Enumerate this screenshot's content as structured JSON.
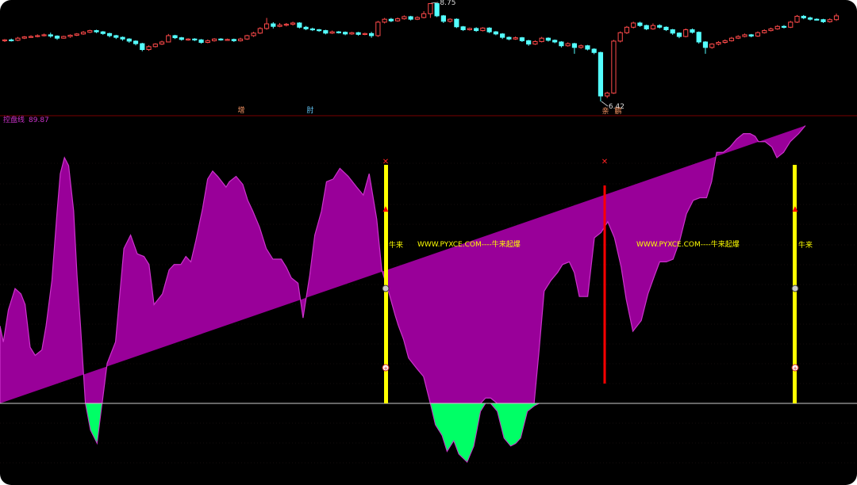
{
  "colors": {
    "background": "#000000",
    "candle_up": "#ff4a4a",
    "candle_down": "#54ffff",
    "divider": "#7a0000",
    "area_positive": "#990099",
    "area_positive_edge": "#cc33cc",
    "area_negative": "#00ff66",
    "signal_bar": "#ffff00",
    "signal_line": "#ff0000",
    "text_yellow": "#ffff00",
    "text_magenta": "#cc33cc"
  },
  "price_panel": {
    "max_label": "8.75",
    "min_label": "6.42",
    "markers": [
      "增",
      "肘",
      "亲",
      "鹏"
    ]
  },
  "indicator_panel": {
    "title": "控盘线",
    "value": "89.87",
    "signal_text": "牛来",
    "watermark": "WWW.PYXCE.COM----牛来起爆",
    "signal_icons": [
      "butterfly-icon",
      "arrow-up-icon",
      "money-bag-icon",
      "plus-circle-icon"
    ]
  },
  "chart_data": [
    {
      "type": "candlestick",
      "title": "",
      "y_marks": {
        "max": 8.75,
        "min": 6.42
      },
      "candles": [
        [
          7.86,
          7.88,
          7.9,
          7.83
        ],
        [
          7.88,
          7.87,
          7.91,
          7.84
        ],
        [
          7.87,
          7.92,
          7.95,
          7.85
        ],
        [
          7.92,
          7.95,
          7.97,
          7.9
        ],
        [
          7.95,
          7.96,
          7.99,
          7.93
        ],
        [
          7.96,
          7.98,
          8.01,
          7.94
        ],
        [
          7.98,
          8.0,
          8.03,
          7.96
        ],
        [
          8.0,
          7.97,
          8.05,
          7.93
        ],
        [
          7.97,
          7.92,
          7.99,
          7.88
        ],
        [
          7.92,
          7.96,
          7.98,
          7.91
        ],
        [
          7.96,
          7.99,
          8.01,
          7.93
        ],
        [
          7.99,
          8.02,
          8.04,
          7.97
        ],
        [
          8.02,
          8.06,
          8.09,
          8.0
        ],
        [
          8.06,
          8.1,
          8.12,
          8.04
        ],
        [
          8.1,
          8.07,
          8.12,
          8.04
        ],
        [
          8.07,
          8.03,
          8.09,
          8.0
        ],
        [
          8.03,
          7.98,
          8.05,
          7.94
        ],
        [
          7.98,
          7.94,
          8.0,
          7.9
        ],
        [
          7.94,
          7.9,
          7.96,
          7.86
        ],
        [
          7.9,
          7.85,
          7.92,
          7.81
        ],
        [
          7.85,
          7.79,
          7.87,
          7.75
        ],
        [
          7.79,
          7.65,
          7.81,
          7.61
        ],
        [
          7.65,
          7.72,
          7.75,
          7.62
        ],
        [
          7.72,
          7.78,
          7.8,
          7.7
        ],
        [
          7.78,
          7.83,
          7.86,
          7.76
        ],
        [
          7.83,
          7.98,
          8.02,
          7.82
        ],
        [
          7.98,
          7.93,
          8.0,
          7.9
        ],
        [
          7.93,
          7.89,
          7.95,
          7.86
        ],
        [
          7.89,
          7.9,
          7.92,
          7.86
        ],
        [
          7.9,
          7.88,
          7.92,
          7.85
        ],
        [
          7.88,
          7.82,
          7.9,
          7.79
        ],
        [
          7.82,
          7.86,
          7.89,
          7.8
        ],
        [
          7.86,
          7.9,
          7.92,
          7.84
        ],
        [
          7.9,
          7.88,
          7.92,
          7.86
        ],
        [
          7.88,
          7.89,
          7.91,
          7.86
        ],
        [
          7.89,
          7.86,
          7.91,
          7.83
        ],
        [
          7.86,
          7.9,
          7.93,
          7.84
        ],
        [
          7.9,
          7.98,
          8.0,
          7.88
        ],
        [
          7.98,
          8.04,
          8.07,
          7.95
        ],
        [
          8.04,
          8.15,
          8.18,
          8.02
        ],
        [
          8.15,
          8.26,
          8.4,
          8.12
        ],
        [
          8.26,
          8.2,
          8.3,
          8.15
        ],
        [
          8.2,
          8.23,
          8.28,
          8.18
        ],
        [
          8.23,
          8.25,
          8.28,
          8.2
        ],
        [
          8.25,
          8.28,
          8.31,
          8.22
        ],
        [
          8.28,
          8.18,
          8.3,
          8.15
        ],
        [
          8.18,
          8.14,
          8.21,
          8.11
        ],
        [
          8.14,
          8.12,
          8.17,
          8.09
        ],
        [
          8.12,
          8.1,
          8.14,
          8.07
        ],
        [
          8.1,
          8.04,
          8.12,
          8.01
        ],
        [
          8.04,
          8.07,
          8.1,
          8.02
        ],
        [
          8.07,
          8.06,
          8.09,
          8.03
        ],
        [
          8.06,
          8.02,
          8.08,
          7.99
        ],
        [
          8.02,
          8.05,
          8.07,
          8.0
        ],
        [
          8.05,
          8.01,
          8.07,
          7.98
        ],
        [
          8.01,
          8.03,
          8.05,
          7.99
        ],
        [
          8.03,
          7.98,
          8.07,
          7.93
        ],
        [
          7.98,
          8.3,
          8.33,
          7.95
        ],
        [
          8.3,
          8.37,
          8.4,
          8.27
        ],
        [
          8.37,
          8.33,
          8.4,
          8.3
        ],
        [
          8.33,
          8.38,
          8.41,
          8.31
        ],
        [
          8.38,
          8.43,
          8.46,
          8.36
        ],
        [
          8.43,
          8.37,
          8.45,
          8.34
        ],
        [
          8.37,
          8.41,
          8.44,
          8.35
        ],
        [
          8.41,
          8.5,
          8.56,
          8.39
        ],
        [
          8.5,
          8.74,
          8.75,
          8.4
        ],
        [
          8.74,
          8.45,
          8.75,
          8.42
        ],
        [
          8.45,
          8.32,
          8.47,
          8.28
        ],
        [
          8.32,
          8.37,
          8.39,
          8.29
        ],
        [
          8.37,
          8.19,
          8.39,
          8.16
        ],
        [
          8.19,
          8.12,
          8.21,
          8.09
        ],
        [
          8.12,
          8.15,
          8.17,
          8.1
        ],
        [
          8.15,
          8.1,
          8.18,
          8.07
        ],
        [
          8.1,
          8.16,
          8.18,
          8.08
        ],
        [
          8.16,
          8.07,
          8.18,
          8.04
        ],
        [
          8.07,
          8.02,
          8.09,
          7.99
        ],
        [
          8.02,
          7.94,
          8.04,
          7.9
        ],
        [
          7.94,
          7.9,
          7.96,
          7.87
        ],
        [
          7.9,
          7.93,
          7.96,
          7.88
        ],
        [
          7.93,
          7.86,
          7.95,
          7.83
        ],
        [
          7.86,
          7.78,
          7.88,
          7.74
        ],
        [
          7.78,
          7.84,
          7.87,
          7.76
        ],
        [
          7.84,
          7.92,
          7.95,
          7.82
        ],
        [
          7.92,
          7.87,
          7.94,
          7.84
        ],
        [
          7.87,
          7.83,
          7.89,
          7.8
        ],
        [
          7.83,
          7.74,
          7.85,
          7.7
        ],
        [
          7.74,
          7.79,
          7.82,
          7.72
        ],
        [
          7.79,
          7.7,
          7.81,
          7.55
        ],
        [
          7.7,
          7.74,
          7.77,
          7.67
        ],
        [
          7.74,
          7.66,
          7.76,
          7.63
        ],
        [
          7.66,
          7.58,
          7.68,
          7.54
        ],
        [
          7.58,
          6.55,
          7.6,
          6.42
        ],
        [
          6.55,
          6.62,
          6.65,
          6.5
        ],
        [
          6.62,
          7.85,
          7.88,
          6.6
        ],
        [
          7.85,
          8.05,
          8.08,
          7.82
        ],
        [
          8.05,
          8.18,
          8.21,
          8.02
        ],
        [
          8.18,
          8.28,
          8.31,
          8.15
        ],
        [
          8.28,
          8.22,
          8.31,
          8.19
        ],
        [
          8.22,
          8.14,
          8.24,
          8.11
        ],
        [
          8.14,
          8.22,
          8.27,
          8.12
        ],
        [
          8.22,
          8.18,
          8.25,
          8.15
        ],
        [
          8.18,
          8.12,
          8.2,
          8.09
        ],
        [
          8.12,
          8.04,
          8.14,
          8.0
        ],
        [
          8.04,
          7.96,
          8.06,
          7.92
        ],
        [
          7.96,
          8.12,
          8.15,
          7.94
        ],
        [
          8.12,
          8.06,
          8.15,
          8.03
        ],
        [
          8.06,
          7.83,
          8.08,
          7.79
        ],
        [
          7.83,
          7.7,
          7.85,
          7.55
        ],
        [
          7.7,
          7.78,
          7.8,
          7.67
        ],
        [
          7.78,
          7.82,
          7.85,
          7.75
        ],
        [
          7.82,
          7.86,
          7.89,
          7.79
        ],
        [
          7.86,
          7.92,
          7.95,
          7.84
        ],
        [
          7.92,
          7.96,
          7.99,
          7.9
        ],
        [
          7.96,
          8.0,
          8.03,
          7.94
        ],
        [
          8.0,
          7.97,
          8.02,
          7.94
        ],
        [
          7.97,
          8.05,
          8.08,
          7.95
        ],
        [
          8.05,
          8.1,
          8.13,
          8.03
        ],
        [
          8.1,
          8.14,
          8.17,
          8.08
        ],
        [
          8.14,
          8.2,
          8.23,
          8.12
        ],
        [
          8.2,
          8.18,
          8.23,
          8.15
        ],
        [
          8.18,
          8.3,
          8.33,
          8.16
        ],
        [
          8.3,
          8.44,
          8.47,
          8.28
        ],
        [
          8.44,
          8.4,
          8.47,
          8.37
        ],
        [
          8.4,
          8.37,
          8.43,
          8.34
        ],
        [
          8.37,
          8.36,
          8.39,
          8.34
        ],
        [
          8.36,
          8.31,
          8.38,
          8.28
        ],
        [
          8.31,
          8.36,
          8.39,
          8.29
        ],
        [
          8.36,
          8.45,
          8.5,
          8.33
        ]
      ]
    },
    {
      "type": "area",
      "title": "控盘线",
      "ylim": [
        -28,
        100
      ],
      "x": [
        0,
        0.4,
        1,
        1.8,
        2.5,
        3,
        3.6,
        4.2,
        5,
        5.5,
        6.2,
        6.8,
        7.2,
        7.7,
        8.2,
        8.8,
        9.2,
        9.6,
        10.2,
        10.8,
        11.6,
        12.2,
        12.8,
        13.8,
        14.8,
        15.6,
        16.4,
        17.2,
        17.8,
        18.4,
        19.4,
        20.2,
        20.8,
        21.6,
        22.2,
        22.8,
        23.4,
        24.2,
        24.8,
        25.4,
        26,
        27,
        27.4,
        28.2,
        29,
        29.6,
        30.2,
        31,
        31.8,
        32.6,
        33.6,
        34.2,
        34.8,
        35.6,
        36.2,
        37,
        37.6,
        38.4,
        39,
        39.8,
        40.6,
        41.6,
        42.6,
        43.4,
        44.1,
        45,
        45.6,
        46.4,
        47.2,
        47.6,
        48.2,
        48.8,
        49.8,
        50.6,
        51.4,
        52,
        52.8,
        53.4,
        54.2,
        54.8,
        55.8,
        56.6,
        57.4,
        58,
        58.6,
        59.4,
        60.2,
        61,
        61.6,
        62.2,
        63,
        63.8,
        64.4,
        65,
        65.8,
        66.6,
        67.2,
        68,
        68.6,
        69.2,
        70.2,
        71,
        71.8,
        72.6,
        73.4,
        74.2,
        74.8,
        75.6,
        76.6,
        77.4,
        78.2,
        78.8,
        79.6,
        80.4,
        81.2,
        82,
        82.8,
        83.6,
        84.4,
        85,
        85.6,
        86.4,
        87.2,
        88,
        88.8,
        89.6,
        90.2,
        90.6,
        91.4,
        92.2,
        92.8,
        93.6,
        94.4,
        95.4,
        96.2,
        97,
        97.8,
        98.6,
        99.4,
        100
      ],
      "values": [
        29,
        23,
        35,
        43,
        41,
        37,
        21,
        18,
        20,
        29,
        46,
        71,
        86,
        92,
        89,
        72,
        48,
        30,
        0,
        -10,
        -15,
        0,
        15,
        23,
        58,
        63,
        56,
        55,
        52,
        37,
        41,
        50,
        52,
        52,
        55,
        53,
        61,
        73,
        84,
        87,
        85,
        81,
        83,
        85,
        82,
        76,
        72,
        66,
        58,
        54,
        54,
        51,
        47,
        45,
        32,
        48,
        63,
        72,
        83,
        84,
        88,
        85,
        81,
        78,
        86,
        69,
        50,
        42,
        33,
        29,
        24,
        17,
        13,
        10,
        0,
        -8,
        -12,
        -18,
        -14,
        -19,
        -22,
        -16,
        -3,
        2,
        2,
        -3,
        -13,
        -16,
        -15,
        -13,
        -3,
        -1,
        20,
        42,
        46,
        49,
        52,
        53,
        49,
        40,
        40,
        62,
        64,
        68,
        62,
        51,
        39,
        27,
        31,
        41,
        48,
        53,
        53,
        54,
        61,
        71,
        76,
        77,
        77,
        83,
        94,
        94,
        96,
        99,
        101,
        101,
        100,
        98,
        98,
        96,
        92,
        94,
        98,
        101,
        104
      ]
    }
  ]
}
